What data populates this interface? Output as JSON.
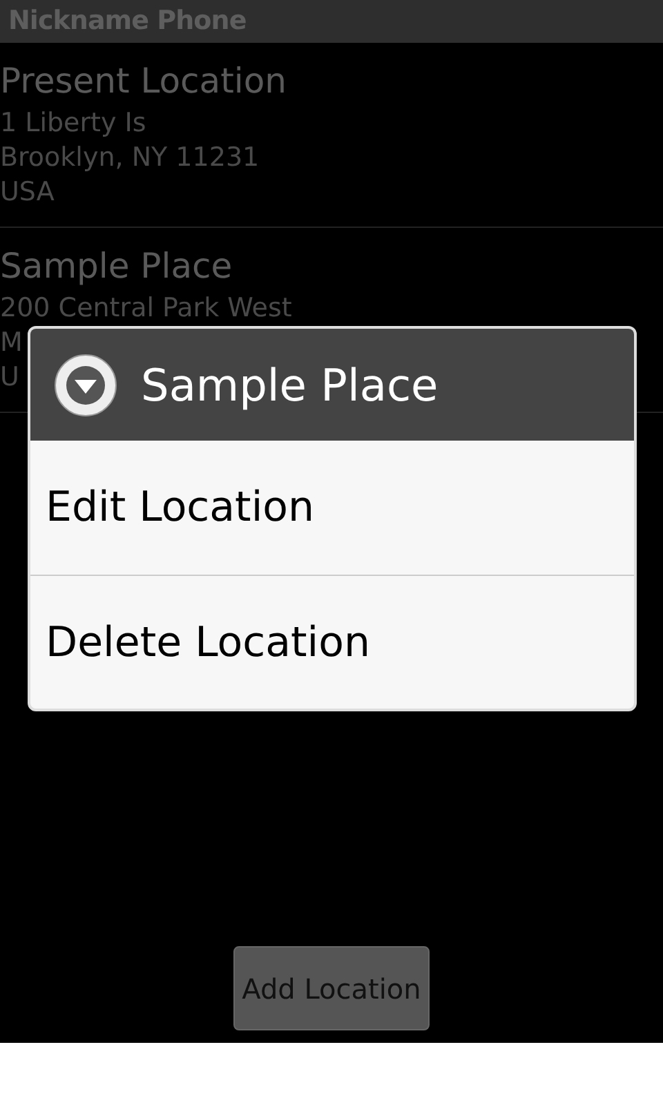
{
  "window": {
    "title": "Nickname Phone"
  },
  "locations": [
    {
      "name": "Present Location",
      "address": [
        "1 Liberty Is",
        "Brooklyn, NY 11231",
        "USA"
      ]
    },
    {
      "name": "Sample Place",
      "address": [
        "200 Central Park West",
        "M",
        "U"
      ]
    }
  ],
  "dialog": {
    "title": "Sample Place",
    "items": [
      {
        "label": "Edit Location"
      },
      {
        "label": "Delete Location"
      }
    ]
  },
  "add_button": {
    "label": "Add Location"
  }
}
